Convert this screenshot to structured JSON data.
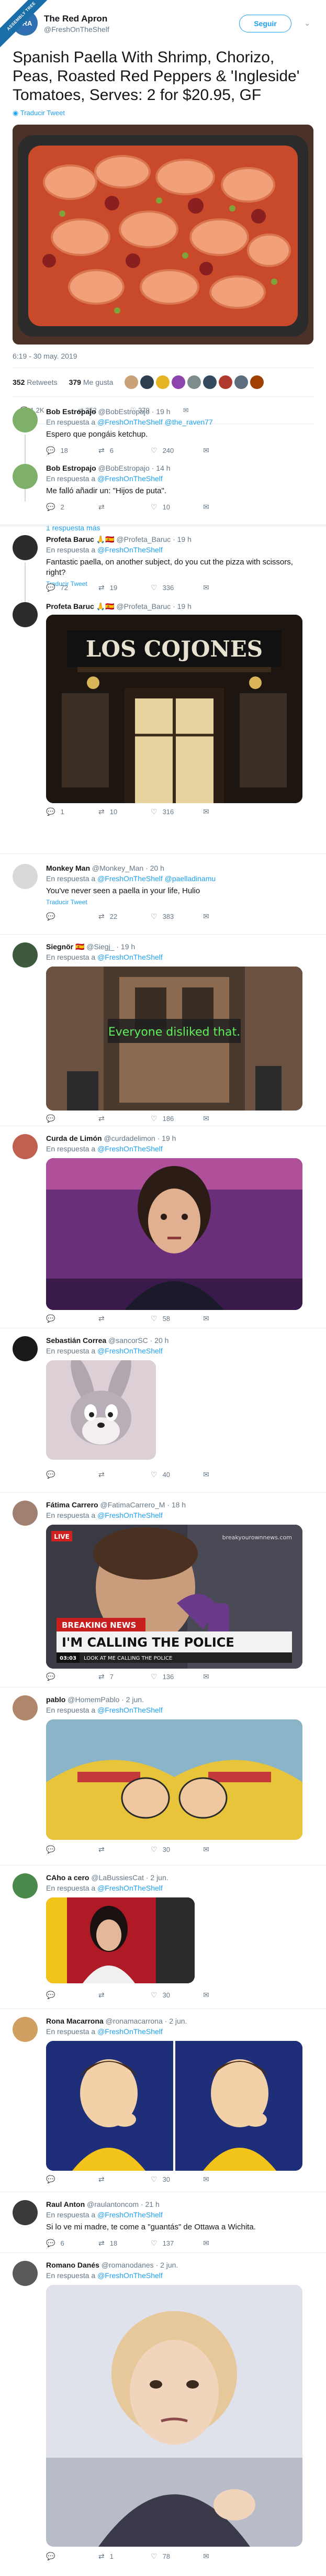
{
  "watermark": "ASSEMBLY TREE",
  "header": {
    "avatar_initials": "TRA",
    "display_name": "The Red Apron",
    "handle": "@FreshOnTheShelf",
    "follow_label": "Seguir",
    "caret": "⌄"
  },
  "tweet": {
    "text": "Spanish Paella With Shrimp, Chorizo, Peas, Roasted Red Peppers & 'Ingleside' Tomatoes, Serves: 2 for $20.95, GF",
    "translate": "Traducir Tweet",
    "timestamp": "6:19 - 30 may. 2019",
    "retweets": "352",
    "retweets_label": "Retweets",
    "likes": "379",
    "likes_label": "Me gusta",
    "actions": {
      "reply": "1,2K",
      "retweet": "352",
      "like": "379"
    }
  },
  "replies": [
    {
      "name": "Bob Estropajo",
      "handle": "@BobEstropajo",
      "time": "· 19 h",
      "reply_prefix": "En respuesta a",
      "reply_to": "@FreshOnTheShelf @the_raven77",
      "text": "Espero que pongáis ketchup.",
      "counts": {
        "reply": "18",
        "retweet": "6",
        "like": "240"
      }
    },
    {
      "name": "Bob Estropajo",
      "handle": "@BobEstropajo",
      "time": "· 14 h",
      "reply_prefix": "En respuesta a",
      "reply_to": "@FreshOnTheShelf",
      "text": "Me falló añadir un: \"Hijos de puta\".",
      "counts": {
        "reply": "2",
        "retweet": "",
        "like": "10"
      }
    },
    {
      "name": "Profeta Baruc 🙏🇪🇸",
      "handle": "@Profeta_Baruc",
      "time": "· 19 h",
      "reply_prefix": "En respuesta a",
      "reply_to": "@FreshOnTheShelf",
      "text": "Fantastic paella, on another subject, do you cut the pizza with scissors, right?",
      "translate": "Traducir Tweet",
      "counts": {
        "reply": "72",
        "retweet": "19",
        "like": "336"
      }
    },
    {
      "name": "Profeta Baruc 🙏🇪🇸",
      "handle": "@Profeta_Baruc",
      "time": "· 19 h",
      "text": "",
      "media_sign": "LOS COJONES",
      "counts": {
        "reply": "1",
        "retweet": "10",
        "like": "316"
      }
    },
    {
      "name": "Monkey Man",
      "handle": "@Monkey_Man",
      "time": "· 20 h",
      "reply_prefix": "En respuesta a",
      "reply_to": "@FreshOnTheShelf @paelladinamu",
      "text": "You've never seen a paella in your life, Hulio",
      "translate": "Traducir Tweet",
      "counts": {
        "reply": "",
        "retweet": "22",
        "like": "383"
      }
    },
    {
      "name": "Siegnör 🇪🇸",
      "handle": "@Siegj_",
      "time": "· 19 h",
      "reply_prefix": "En respuesta a",
      "reply_to": "@FreshOnTheShelf",
      "text": "",
      "media_caption": "Everyone disliked that.",
      "counts": {
        "reply": "",
        "retweet": "",
        "like": "186"
      }
    },
    {
      "name": "Curda de Limón",
      "handle": "@curdadelimon",
      "time": "· 19 h",
      "reply_prefix": "En respuesta a",
      "reply_to": "@FreshOnTheShelf",
      "text": "",
      "counts": {
        "reply": "",
        "retweet": "",
        "like": "58"
      }
    },
    {
      "name": "Sebastián Correa",
      "handle": "@sancorSC",
      "time": "· 20 h",
      "reply_prefix": "En respuesta a",
      "reply_to": "@FreshOnTheShelf",
      "text": "",
      "counts": {
        "reply": "",
        "retweet": "",
        "like": "40"
      }
    },
    {
      "name": "Fátima Carrero",
      "handle": "@FatimaCarrero_M",
      "time": "· 18 h",
      "reply_prefix": "En respuesta a",
      "reply_to": "@FreshOnTheShelf",
      "text": "",
      "media_tag": "LIVE",
      "media_watermark": "breakyourownnews.com",
      "media_banner": "BREAKING NEWS",
      "media_headline": "I'M CALLING THE POLICE",
      "media_ticker_time": "03:03",
      "media_ticker": "LOOK AT ME CALLING THE POLICE",
      "counts": {
        "reply": "",
        "retweet": "7",
        "like": "136"
      }
    },
    {
      "name": "pablo",
      "handle": "@HomemPablo",
      "time": "· 2 jun.",
      "reply_prefix": "En respuesta a",
      "reply_to": "@FreshOnTheShelf",
      "text": "",
      "counts": {
        "reply": "",
        "retweet": "",
        "like": "30"
      }
    },
    {
      "name": "CAho a cero",
      "handle": "@LaBussiesCat",
      "time": "· 2 jun.",
      "reply_prefix": "En respuesta a",
      "reply_to": "@FreshOnTheShelf",
      "text": "",
      "counts": {
        "reply": "",
        "retweet": "",
        "like": "30"
      }
    },
    {
      "name": "Rona Macarrona",
      "handle": "@ronamacarrona",
      "time": "· 2 jun.",
      "reply_prefix": "En respuesta a",
      "reply_to": "@FreshOnTheShelf",
      "text": "",
      "counts": {
        "reply": "",
        "retweet": "",
        "like": "30"
      }
    },
    {
      "name": "Raul Anton",
      "handle": "@raulantoncom",
      "time": "· 21 h",
      "reply_prefix": "En respuesta a",
      "reply_to": "@FreshOnTheShelf",
      "text": "Si lo ve mi madre, te come a \"guantás\" de Ottawa a Wichita.",
      "counts": {
        "reply": "6",
        "retweet": "18",
        "like": "137"
      }
    },
    {
      "name": "Romano Danés",
      "handle": "@romanodanes",
      "time": "· 2 jun.",
      "reply_prefix": "En respuesta a",
      "reply_to": "@FreshOnTheShelf",
      "text": "",
      "counts": {
        "reply": "",
        "retweet": "1",
        "like": "78"
      }
    }
  ],
  "more_replies": "1 respuesta más",
  "icons": {
    "reply": "reply-icon",
    "retweet": "retweet-icon",
    "like": "heart-icon",
    "dm": "envelope-icon",
    "globe": "globe-icon"
  }
}
